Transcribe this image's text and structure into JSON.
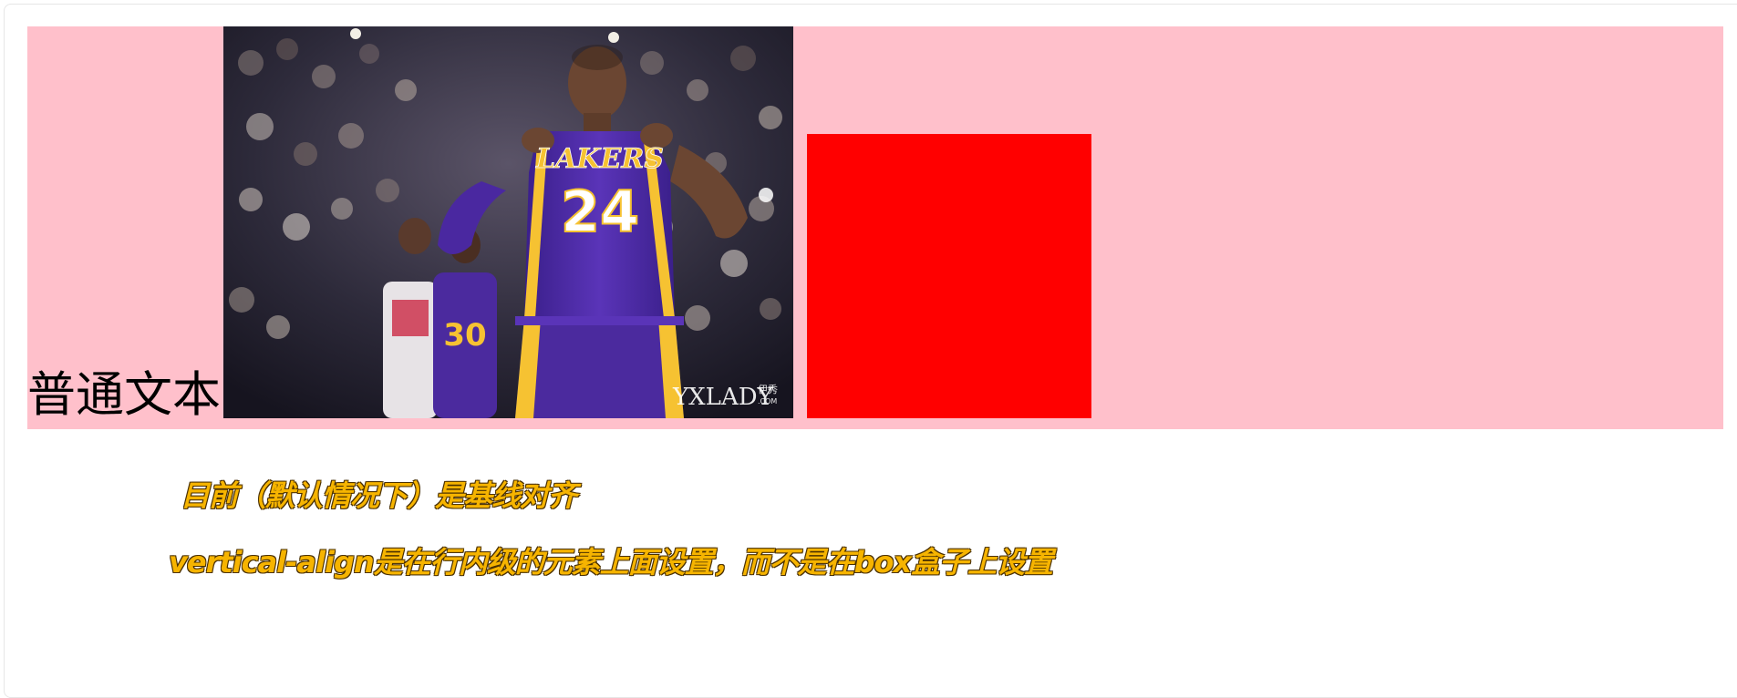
{
  "demo": {
    "inline_text": "普通文本",
    "box_color": "#ffc0cb",
    "square_color": "#ff0000",
    "photo": {
      "icon": "basketball-player-photo",
      "jersey_team": "LAKERS",
      "jersey_number": "24",
      "second_jersey_number": "30",
      "watermark": "YXLADY",
      "watermark_small": "伊秀",
      "watermark_domain": ".COM"
    }
  },
  "notes": {
    "line1": "目前（默认情况下）是基线对齐",
    "line2": "vertical-align是在行内级的元素上面设置，而不是在box盒子上设置",
    "color": "#f6b400"
  }
}
